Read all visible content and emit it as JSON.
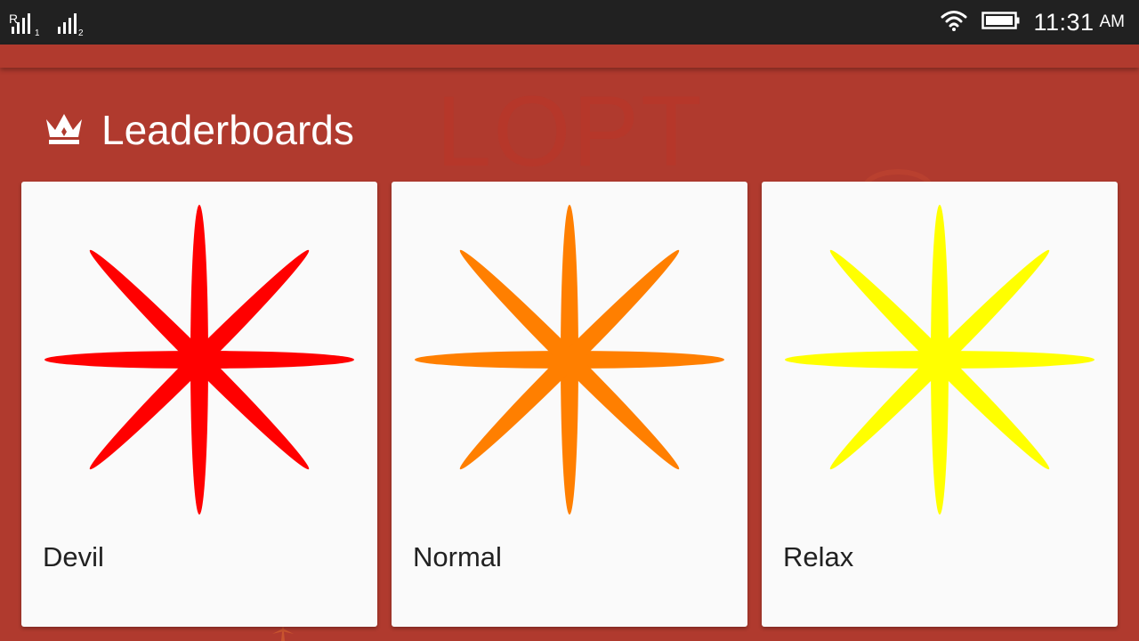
{
  "status_bar": {
    "sim1_marker": "R",
    "sim1_index": "1",
    "sim2_index": "2",
    "time": "11:31",
    "ampm": "AM",
    "icons": [
      "signal-icon",
      "signal-icon",
      "wifi-icon",
      "battery-icon"
    ]
  },
  "background": {
    "watermark": "LOPT"
  },
  "header": {
    "icon": "crown-icon",
    "title": "Leaderboards"
  },
  "cards": [
    {
      "label": "Devil",
      "icon": "star-icon",
      "color": "#ff0000"
    },
    {
      "label": "Normal",
      "icon": "star-icon",
      "color": "#ff7f00"
    },
    {
      "label": "Relax",
      "icon": "star-icon",
      "color": "#ffff00"
    }
  ],
  "colors": {
    "background": "#b03a2e",
    "status_bar": "#212121",
    "card": "#fafafa"
  }
}
